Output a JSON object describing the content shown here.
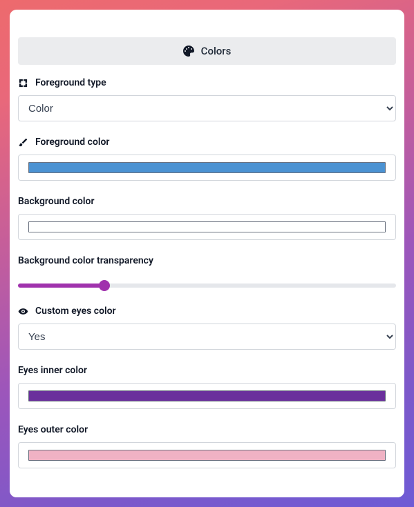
{
  "header": {
    "title": "Colors"
  },
  "foreground_type": {
    "label": "Foreground type",
    "value": "Color",
    "options": [
      "Color"
    ]
  },
  "foreground_color": {
    "label": "Foreground color",
    "value": "#4b92d2"
  },
  "background_color": {
    "label": "Background color",
    "value": "#ffffff"
  },
  "background_transparency": {
    "label": "Background color transparency",
    "value": 22,
    "min": 0,
    "max": 100
  },
  "custom_eyes": {
    "label": "Custom eyes color",
    "value": "Yes",
    "options": [
      "Yes"
    ]
  },
  "eyes_inner": {
    "label": "Eyes inner color",
    "value": "#6a2f9c"
  },
  "eyes_outer": {
    "label": "Eyes outer color",
    "value": "#f0b2c4"
  }
}
